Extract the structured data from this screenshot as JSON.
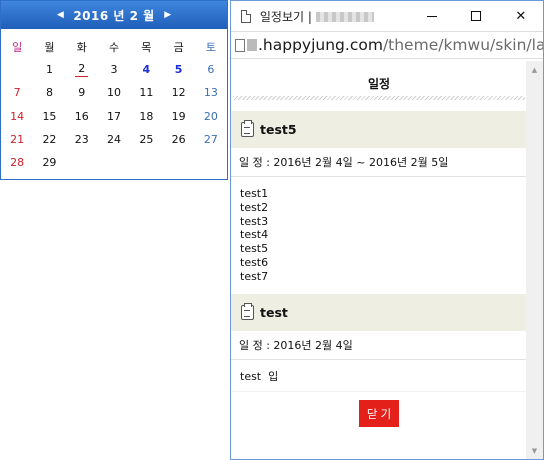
{
  "calendar": {
    "prev_icon": "◀",
    "next_icon": "▶",
    "title": "2016 년 2 월",
    "weekdays": [
      "일",
      "월",
      "화",
      "수",
      "목",
      "금",
      "토"
    ],
    "weeks": [
      [
        "",
        "1",
        "2",
        "3",
        "4",
        "5",
        "6"
      ],
      [
        "7",
        "8",
        "9",
        "10",
        "11",
        "12",
        "13"
      ],
      [
        "14",
        "15",
        "16",
        "17",
        "18",
        "19",
        "20"
      ],
      [
        "21",
        "22",
        "23",
        "24",
        "25",
        "26",
        "27"
      ],
      [
        "28",
        "29",
        "",
        "",
        "",
        "",
        ""
      ]
    ],
    "today": "2",
    "event_days": [
      "4",
      "5"
    ],
    "colors": {
      "header": "#2f6fc8",
      "sunday": "#d0202a",
      "saturday": "#3a6fb4",
      "event_day": "#1a2fd6"
    }
  },
  "window": {
    "title": "일정보기 |",
    "minimize_icon": "minimize-icon",
    "maximize_icon": "maximize-icon",
    "close_icon": "✕",
    "address_host": ".happyjung.com",
    "address_path": "/theme/kmwu/skin/lat"
  },
  "schedule": {
    "header": "일정",
    "events": [
      {
        "title": "test5",
        "date": "일 정 : 2016년 2월 4일 ~ 2016년 2월 5일",
        "lines": [
          "test1",
          "test2",
          "test3",
          "test4",
          "test5",
          "test6",
          "test7"
        ]
      },
      {
        "title": "test",
        "date": "일 정 : 2016년 2월 4일",
        "lines": [
          "test  입"
        ]
      }
    ],
    "close_label": "닫 기",
    "close_color": "#e4201a",
    "event_bg": "#eeeee3"
  }
}
